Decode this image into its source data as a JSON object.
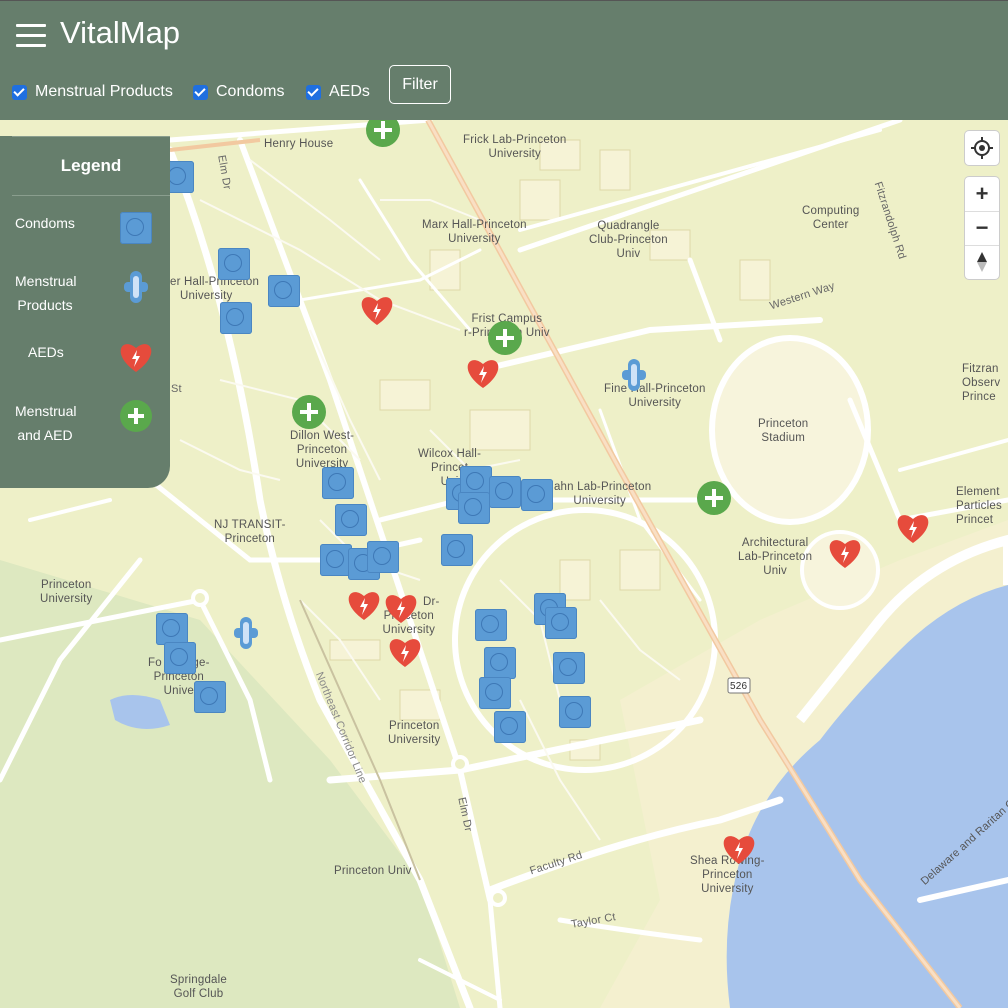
{
  "app": {
    "title": "VitalMap"
  },
  "filters": {
    "items": [
      {
        "label": "Menstrual Products",
        "checked": true
      },
      {
        "label": "Condoms",
        "checked": true
      },
      {
        "label": "AEDs",
        "checked": true
      }
    ],
    "button_label": "Filter"
  },
  "legend": {
    "title": "Legend",
    "items": [
      {
        "label_lines": [
          "Condoms"
        ],
        "icon": "condom-marker-icon"
      },
      {
        "label_lines": [
          "Menstrual",
          "Products"
        ],
        "icon": "menstrual-pad-marker-icon"
      },
      {
        "label_lines": [
          "AEDs"
        ],
        "icon": "aed-heart-marker-icon"
      },
      {
        "label_lines": [
          "Menstrual",
          "and AED"
        ],
        "icon": "green-cross-marker-icon"
      }
    ]
  },
  "map_controls": {
    "locate_icon": "locate-crosshair-icon",
    "zoom_in": "+",
    "zoom_out": "−",
    "compass_icon": "compass-north-icon"
  },
  "map_labels": {
    "henry_house": "Henry House",
    "frick_lab": [
      "Frick Lab-Princeton",
      "University"
    ],
    "marx_hall": [
      "Marx Hall-Princeton",
      "University"
    ],
    "quadrangle": [
      "Quadrangle",
      "Club-Princeton",
      "Univ"
    ],
    "computing": [
      "Computing",
      "Center"
    ],
    "fitzrandolph": "Fitzrandolph Rd",
    "elm_dr_top": "Elm Dr",
    "hall_princeton": [
      "er Hall-Princeton",
      "University"
    ],
    "western_way": "Western Way",
    "frist": [
      "Frist Campus",
      "r-Princeton Univ"
    ],
    "fine_hall": [
      "Fine Hall-Princeton",
      "University"
    ],
    "princeton_stadium": [
      "Princeton",
      "Stadium"
    ],
    "fitzrand_obs": [
      "Fitzran",
      "Observ",
      "Prince"
    ],
    "dillon": [
      "Dillon West-",
      "Princeton",
      "University"
    ],
    "wilcox": [
      "Wilcox Hall-",
      "Princet",
      "Uni"
    ],
    "jadwin": [
      "Jahn Lab-Princeton",
      "University"
    ],
    "elementary": [
      "Element",
      "Particles",
      "Princet"
    ],
    "nj_transit": [
      "NJ TRANSIT-",
      "Princeton"
    ],
    "architectural": [
      "Architectural",
      "Lab-Princeton",
      "Univ"
    ],
    "princeton_univ_left": [
      "Princeton",
      "University"
    ],
    "dr_princeton": [
      "Dr-",
      "Princeton",
      "University"
    ],
    "forbes": [
      "Fo     College-",
      "Princeton",
      "Unive"
    ],
    "route_526": "526",
    "northeast_corridor": "Northeast Corridor Line",
    "princeton_univ_mid": [
      "Princeton",
      "University"
    ],
    "elm_dr_bottom": "Elm Dr",
    "faculty_rd": "Faculty Rd",
    "shea": [
      "Shea Rowing-",
      "Princeton",
      "University"
    ],
    "princeton_univ_bottom": "Princeton Univ",
    "delaware": "Delaware and Raritan Ca",
    "taylor_ct": "Taylor Ct",
    "springdale": [
      "Springdale",
      "Golf Club"
    ],
    "st": "St"
  },
  "map_markers": {
    "condoms_count": 28,
    "aeds_count": 9,
    "menstrual_count": 2,
    "combined_count": 4
  },
  "colors": {
    "header": "#667e6c",
    "condom_marker": "#5b9bd5",
    "aed_marker": "#e64b3c",
    "combined_marker": "#5aa84c",
    "map_land": "#eef0c8",
    "water": "#a8c4ec"
  }
}
